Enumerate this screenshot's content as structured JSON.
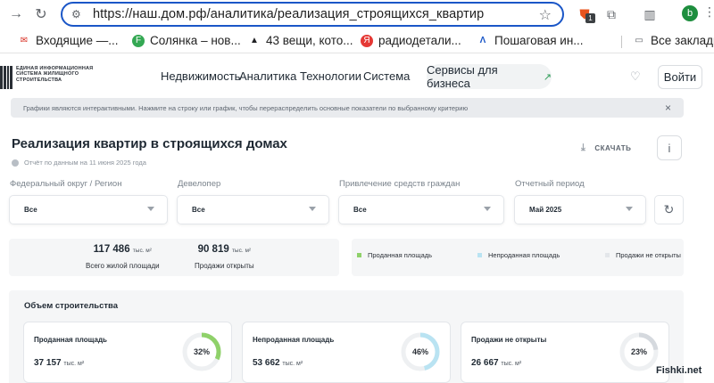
{
  "browser": {
    "url": "https://наш.дом.рф/аналитика/реализация_строящихся_квартир",
    "profile_initial": "b",
    "ext_badge": "1",
    "bookmarks": [
      {
        "label": "Входящие —...",
        "color": "#d93025",
        "icon": "mail-icon"
      },
      {
        "label": "Солянка – нов...",
        "color": "#34a853",
        "icon": "site-icon"
      },
      {
        "label": "43 вещи, кото...",
        "color": "#202124",
        "icon": "penguin-icon"
      },
      {
        "label": "радиодетали...",
        "color": "#e53935",
        "icon": "yandex-icon"
      },
      {
        "label": "Пошаговая ин...",
        "color": "#1a56c7",
        "icon": "site-icon"
      },
      {
        "label": "Все закладки",
        "color": "#5f6368",
        "icon": "folder-icon"
      }
    ]
  },
  "header": {
    "logo_text": "ЕДИНАЯ ИНФОРМАЦИОННАЯ СИСТЕМА ЖИЛИЩНОГО СТРОИТЕЛЬСТВА",
    "nav": [
      "Недвижимость",
      "Аналитика",
      "Технологии",
      "Система"
    ],
    "business_button": "Сервисы для бизнеса",
    "login": "Войти"
  },
  "notice": {
    "text": "Графики являются интерактивными. Нажмите на строку или график, чтобы перераспределить основные показатели по выбранному критерию",
    "close": "×"
  },
  "page": {
    "title": "Реализация квартир в строящихся домах",
    "report_date": "Отчёт по данным на 11 июня 2025 года",
    "download": "СКАЧАТЬ",
    "info": "i"
  },
  "filters": [
    {
      "label": "Федеральный округ / Регион",
      "value": "Все"
    },
    {
      "label": "Девелопер",
      "value": "Все"
    },
    {
      "label": "Привлечение средств граждан",
      "value": "Все"
    },
    {
      "label": "Отчетный период",
      "value": "Май 2025"
    }
  ],
  "stats": [
    {
      "value": "117 486",
      "unit": "тыс. м²",
      "label": "Всего жилой площади"
    },
    {
      "value": "90 819",
      "unit": "тыс. м²",
      "label": "Продажи открыты"
    }
  ],
  "legend": [
    {
      "label": "Проданная площадь",
      "color": "#8fd16a"
    },
    {
      "label": "Непроданная площадь",
      "color": "#b9e3f2"
    },
    {
      "label": "Продажи не открыты",
      "color": "#e3e6ea"
    }
  ],
  "volume": {
    "title": "Объем строительства",
    "cards": [
      {
        "label": "Проданная площадь",
        "value": "37 157",
        "unit": "тыс. м²",
        "percent_text": "32%",
        "percent": 32,
        "color": "#8fd16a"
      },
      {
        "label": "Непроданная площадь",
        "value": "53 662",
        "unit": "тыс. м²",
        "percent_text": "46%",
        "percent": 46,
        "color": "#b9e3f2"
      },
      {
        "label": "Продажи не открыты",
        "value": "26 667",
        "unit": "тыс. м²",
        "percent_text": "23%",
        "percent": 23,
        "color": "#d5d9de"
      }
    ]
  },
  "watermark": "Fishki.net"
}
